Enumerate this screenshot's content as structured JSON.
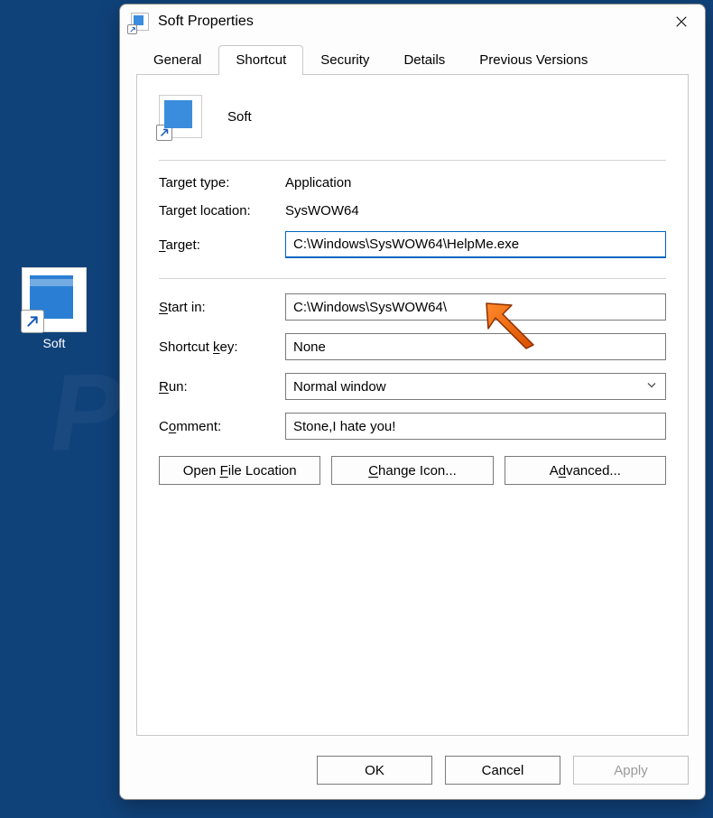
{
  "desktop": {
    "icon_label": "Soft"
  },
  "dialog": {
    "title": "Soft Properties",
    "tabs": [
      "General",
      "Shortcut",
      "Security",
      "Details",
      "Previous Versions"
    ],
    "active_tab": 1,
    "header_name": "Soft",
    "labels": {
      "target_type": "Target type:",
      "target_location": "Target location:",
      "target": "Target:",
      "start_in": "Start in:",
      "shortcut_key": "Shortcut key:",
      "run": "Run:",
      "comment": "Comment:"
    },
    "values": {
      "target_type": "Application",
      "target_location": "SysWOW64",
      "target": "C:\\Windows\\SysWOW64\\HelpMe.exe",
      "start_in": "C:\\Windows\\SysWOW64\\",
      "shortcut_key": "None",
      "run": "Normal window",
      "comment": "Stone,I hate you!"
    },
    "buttons": {
      "open_file_location": "Open File Location",
      "change_icon": "Change Icon...",
      "advanced": "Advanced...",
      "ok": "OK",
      "cancel": "Cancel",
      "apply": "Apply"
    }
  },
  "watermark": "PCrisk.com"
}
